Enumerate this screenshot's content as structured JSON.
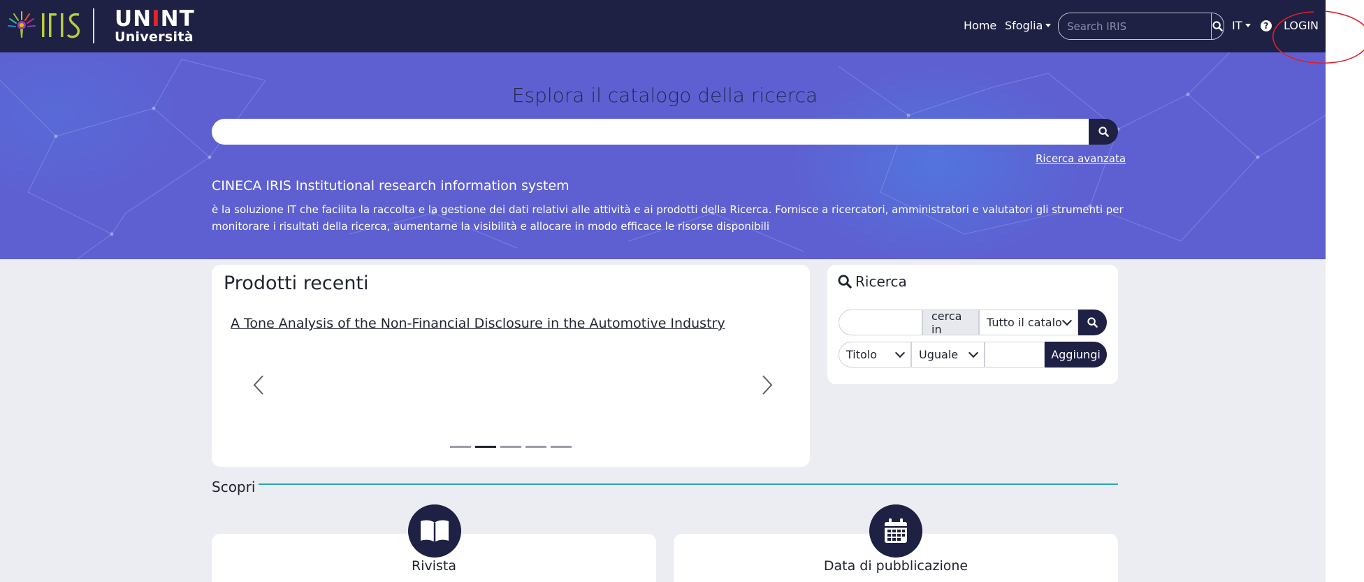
{
  "navbar": {
    "logo_iris": "IRIS",
    "logo_unint_top": "UNINT",
    "logo_unint_bottom": "Università",
    "home": "Home",
    "sfoglia": "Sfoglia",
    "search_placeholder": "Search IRIS",
    "lang": "IT",
    "help": "?",
    "login": "LOGIN"
  },
  "hero": {
    "title": "Esplora il catalogo della ricerca",
    "advanced_search": "Ricerca avanzata",
    "subtitle": "CINECA IRIS Institutional research information system",
    "description": "è la soluzione IT che facilita la raccolta e la gestione dei dati relativi alle attività e ai prodotti della Ricerca. Fornisce a ricercatori, amministratori e valutatori gli strumenti per monitorare i risultati della ricerca, aumentarne la visibilità e allocare in modo efficace le risorse disponibili"
  },
  "recent": {
    "title": "Prodotti recenti",
    "item": "A Tone Analysis of the Non-Financial Disclosure in the Automotive Industry",
    "slides_total": 5,
    "active_slide": 2
  },
  "search_panel": {
    "title": "Ricerca",
    "search_in_label": "cerca in",
    "scope_select": "Tutto il catalo",
    "field_select": "Titolo",
    "operator_select": "Uguale",
    "add_button": "Aggiungi"
  },
  "discover": {
    "title": "Scopri",
    "categories": [
      {
        "label": "Rivista",
        "icon": "book-icon"
      },
      {
        "label": "Data di pubblicazione",
        "icon": "calendar-icon"
      }
    ]
  },
  "colors": {
    "navbar": "#1e2144",
    "hero": "#5e60d2",
    "accent_line": "#26a8b3",
    "annotation": "#e0202a"
  }
}
